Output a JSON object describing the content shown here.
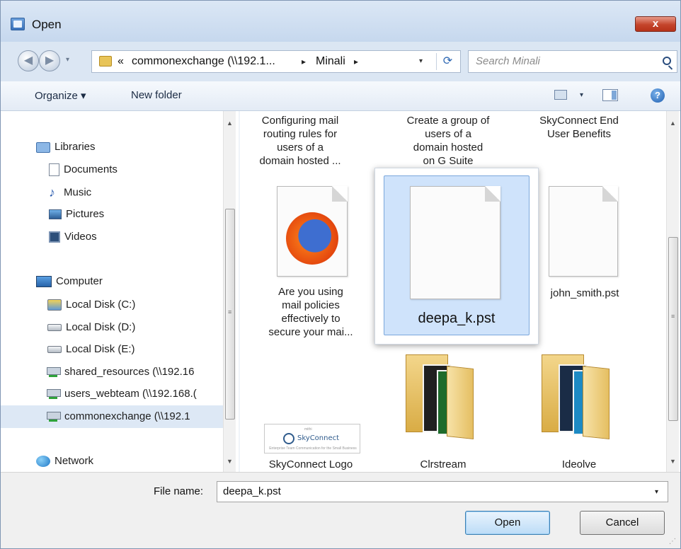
{
  "window": {
    "title": "Open",
    "close_glyph": "x"
  },
  "address_bar": {
    "overflow_glyph": "«",
    "crumbs": [
      "commonexchange (\\\\192.1...",
      "Minali"
    ],
    "separator": "▸",
    "dropdown_glyph": "▾",
    "refresh_glyph": "⟳"
  },
  "search": {
    "placeholder": "Search Minali"
  },
  "toolbar": {
    "organize_label": "Organize ▾",
    "new_folder_label": "New folder",
    "views_drop_glyph": "▾",
    "help_glyph": "?"
  },
  "nav": {
    "libraries": "Libraries",
    "documents": "Documents",
    "music": "Music",
    "pictures": "Pictures",
    "videos": "Videos",
    "computer": "Computer",
    "disk_c": "Local Disk (C:)",
    "disk_d": "Local Disk (D:)",
    "disk_e": "Local Disk (E:)",
    "share1": "shared_resources (\\\\192.16",
    "share2": "users_webteam (\\\\192.168.(",
    "share3": "commonexchange (\\\\192.1",
    "network": "Network",
    "music_glyph": "♪"
  },
  "files": {
    "item1_lines": [
      "Configuring mail",
      "routing rules for",
      "users of a",
      "domain hosted ..."
    ],
    "item2_lines": [
      "Create a group of",
      "users of a",
      "domain hosted",
      "on G Suite"
    ],
    "item3_lines": [
      "SkyConnect End",
      "User Benefits"
    ],
    "item4_lines": [
      "Are you using",
      "mail policies",
      "effectively to",
      "secure your mai..."
    ],
    "selected": "deepa_k.pst",
    "item6": "john_smith.pst",
    "item7": "SkyConnect Logo",
    "item8": "Clrstream",
    "item9": "Ideolve",
    "logo_text": "SkyConnect",
    "logo_top": "mithi",
    "logo_sub": "Enterprise Team Communication for the Small Business"
  },
  "bottom": {
    "file_name_label": "File name:",
    "file_name_value": "deepa_k.pst",
    "dropdown_glyph": "▾",
    "open_label": "Open",
    "cancel_label": "Cancel"
  },
  "scroll_glyphs": {
    "up": "▲",
    "down": "▼",
    "grip": "≡"
  }
}
